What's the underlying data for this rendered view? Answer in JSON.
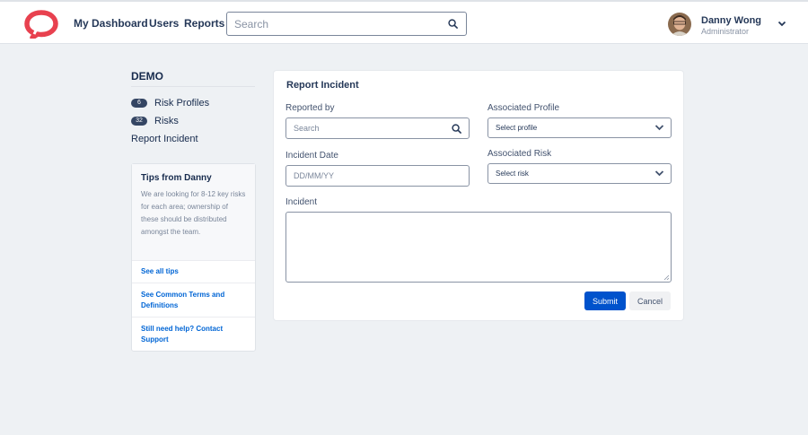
{
  "nav": {
    "dashboard": "My Dashboard",
    "users": "Users",
    "reports": "Reports",
    "search_placeholder": "Search"
  },
  "user": {
    "name": "Danny Wong",
    "role": "Administrator"
  },
  "sidebar": {
    "title": "DEMO",
    "items": [
      {
        "badge": "6",
        "label": "Risk Profiles"
      },
      {
        "badge": "32",
        "label": "Risks"
      },
      {
        "label": "Report Incident"
      }
    ]
  },
  "tips": {
    "title": "Tips from Danny",
    "text": "We are looking for 8-12 key risks for each area; ownership of these should be distributed amongst the team.",
    "links": [
      "See all tips",
      "See Common Terms and Definitions",
      "Still need help? Contact Support"
    ]
  },
  "form": {
    "title": "Report Incident",
    "reported_by_label": "Reported by",
    "reported_by_placeholder": "Search",
    "incident_date_label": "Incident Date",
    "incident_date_placeholder": "DD/MM/YY",
    "associated_profile_label": "Associated Profile",
    "associated_profile_value": "Select profile",
    "associated_risk_label": "Associated Risk",
    "associated_risk_value": "Select risk",
    "incident_label": "Incident",
    "submit_label": "Submit",
    "cancel_label": "Cancel"
  },
  "colors": {
    "brand": "#e8414f",
    "primary_button": "#0052cc",
    "link": "#0065d5",
    "badge": "#344563",
    "background": "#eef1f4"
  }
}
